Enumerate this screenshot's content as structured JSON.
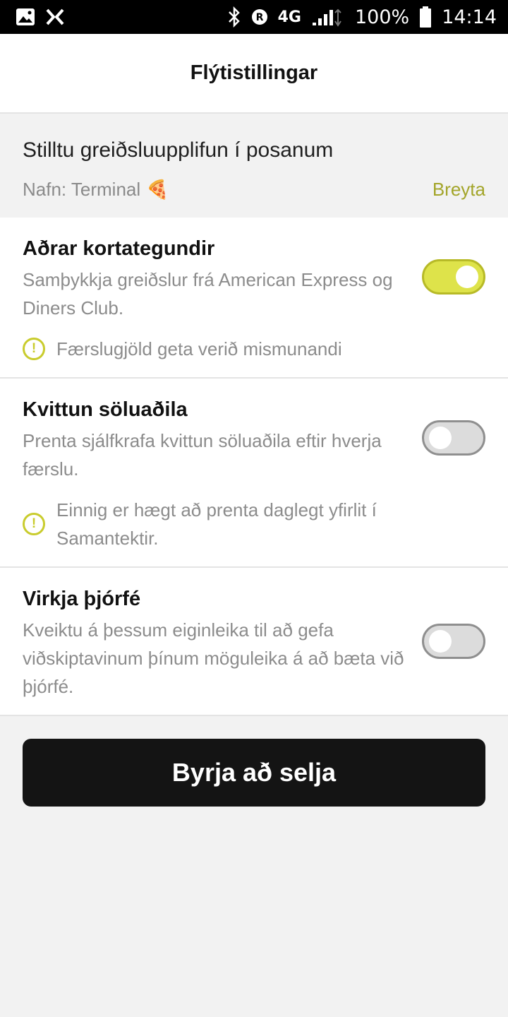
{
  "status_bar": {
    "network": "4G",
    "battery_percent": "100%",
    "time": "14:14"
  },
  "header": {
    "title": "Flýtistillingar"
  },
  "terminal": {
    "title": "Stilltu greiðsluupplifun í posanum",
    "name": "Nafn: Terminal",
    "name_emoji": "🍕",
    "edit_label": "Breyta"
  },
  "settings": [
    {
      "title": "Aðrar kortategundir",
      "description": "Samþykkja greiðslur frá American Express og Diners Club.",
      "warning": "Færslugjöld geta verið mismunandi",
      "enabled": true
    },
    {
      "title": "Kvittun söluaðila",
      "description": "Prenta sjálfkrafa kvittun söluaðila eftir hverja færslu.",
      "warning": "Einnig er hægt að prenta daglegt yfirlit í Samantektir.",
      "enabled": false
    },
    {
      "title": "Virkja þjórfé",
      "description": "Kveiktu á þessum eiginleika til að gefa viðskiptavinum þínum möguleika á að bæta við þjórfé.",
      "enabled": false
    }
  ],
  "cta": {
    "label": "Byrja að selja"
  },
  "colors": {
    "accent": "#dee34a",
    "link": "#a3a52a",
    "warning": "#c9cc2d"
  }
}
